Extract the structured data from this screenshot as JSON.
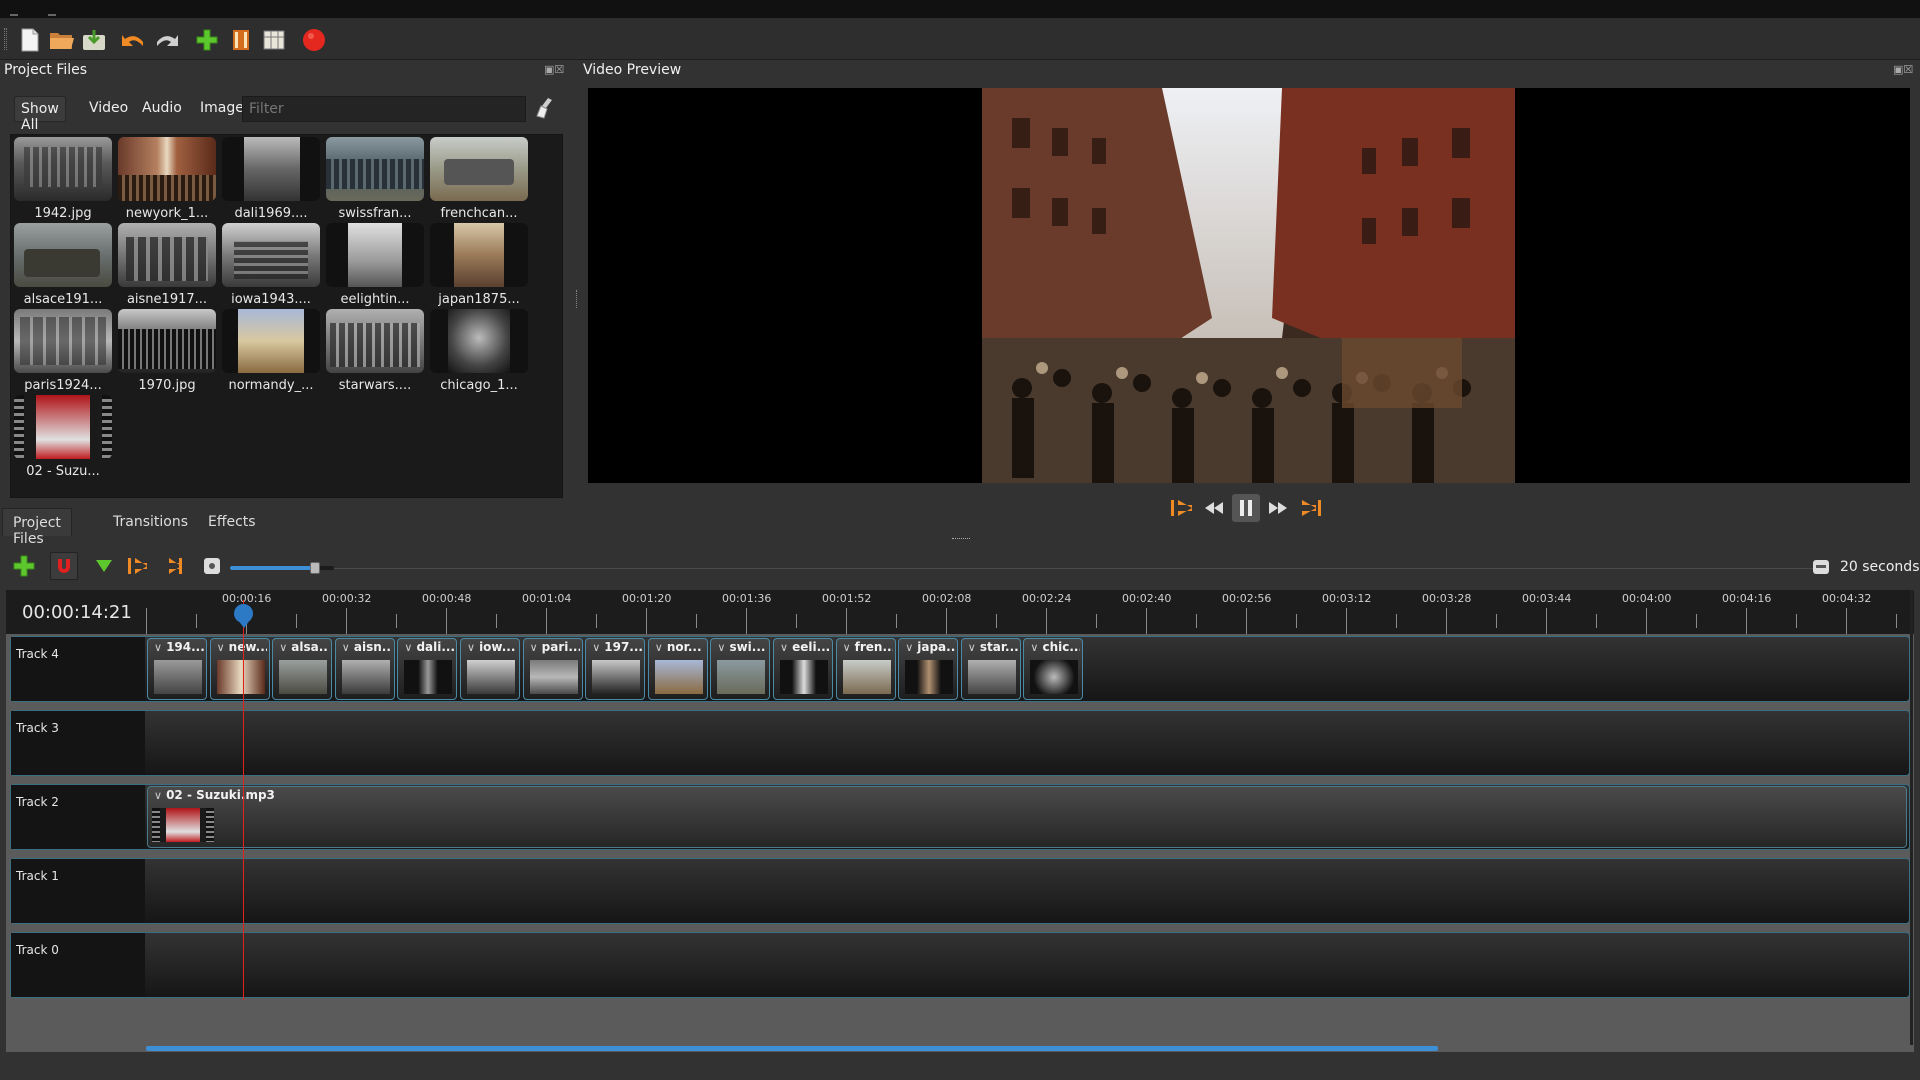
{
  "toolbar": {
    "buttons": [
      "new-project-icon",
      "open-project-icon",
      "save-project-icon",
      "undo-icon",
      "redo-icon",
      "import-files-icon",
      "choose-profile-icon",
      "fullscreen-icon",
      "export-video-icon"
    ]
  },
  "project_files": {
    "title": "Project Files",
    "filters": [
      "Show All",
      "Video",
      "Audio",
      "Image"
    ],
    "filter_placeholder": "Filter",
    "items": [
      "1942.jpg",
      "newyork_1...",
      "dali1969....",
      "swissfran...",
      "frenchcan...",
      "alsace191...",
      "aisne1917...",
      "iowa1943....",
      "eelightin...",
      "japan1875...",
      "paris1924...",
      "1970.jpg",
      "normandy_...",
      "starwars....",
      "chicago_1...",
      "02 - Suzu..."
    ]
  },
  "tabs": [
    "Project Files",
    "Transitions",
    "Effects"
  ],
  "video_preview": {
    "title": "Video Preview"
  },
  "timeline": {
    "zoom_label": "20 seconds",
    "zoom_fraction": 0.82,
    "timecode": "00:00:14:21",
    "ruler_labels": [
      "00:00:16",
      "00:00:32",
      "00:00:48",
      "00:01:04",
      "00:01:20",
      "00:01:36",
      "00:01:52",
      "00:02:08",
      "00:02:24",
      "00:02:40",
      "00:02:56",
      "00:03:12",
      "00:03:28",
      "00:03:44",
      "00:04:00",
      "00:04:16",
      "00:04:32"
    ],
    "tracks": [
      {
        "name": "Track 4",
        "clips": [
          "194...",
          "new...",
          "alsa...",
          "aisn...",
          "dali...",
          "iow...",
          "pari...",
          "197...",
          "nor...",
          "swi...",
          "eeli...",
          "fren...",
          "japa...",
          "star...",
          "chic..."
        ]
      },
      {
        "name": "Track 3",
        "clips": []
      },
      {
        "name": "Track 2",
        "clips": [
          "02 - Suzuki.mp3"
        ]
      },
      {
        "name": "Track 1",
        "clips": []
      },
      {
        "name": "Track 0",
        "clips": []
      }
    ]
  },
  "colors": {
    "accent": "#3d8fd6",
    "playhead": "#e0241d",
    "record": "#e5281f",
    "orange": "#f08a24",
    "green": "#5cc82e"
  }
}
